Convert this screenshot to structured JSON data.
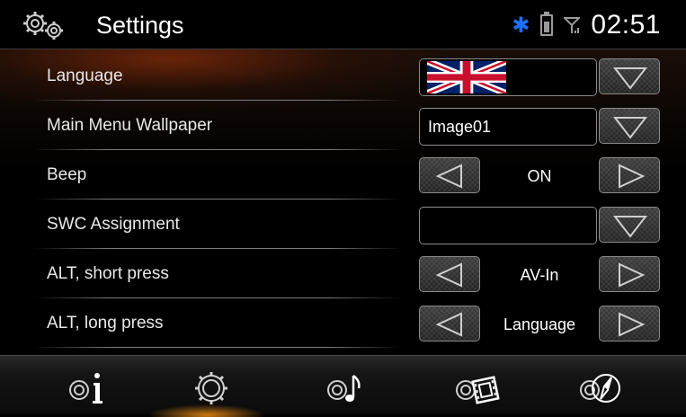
{
  "header": {
    "title": "Settings",
    "clock": "02:51",
    "icons": [
      "gears-icon",
      "bluetooth-icon",
      "battery-icon",
      "signal-icon"
    ],
    "bluetooth_color": "#1e6fff"
  },
  "settings": [
    {
      "label": "Language",
      "control": "dropdown",
      "value_icon": "uk-flag-icon"
    },
    {
      "label": "Main Menu Wallpaper",
      "control": "dropdown",
      "value": "Image01"
    },
    {
      "label": "Beep",
      "control": "stepper",
      "value": "ON"
    },
    {
      "label": "SWC Assignment",
      "control": "dropdown",
      "value": ""
    },
    {
      "label": "ALT, short press",
      "control": "stepper",
      "value": "AV-In"
    },
    {
      "label": "ALT, long press",
      "control": "stepper",
      "value": "Language"
    }
  ],
  "footer": {
    "nav": [
      "info-settings-icon",
      "general-settings-icon",
      "audio-settings-icon",
      "video-settings-icon",
      "navigation-settings-icon"
    ],
    "active": "general-settings-icon",
    "active_glow_color": "#ff9614"
  }
}
